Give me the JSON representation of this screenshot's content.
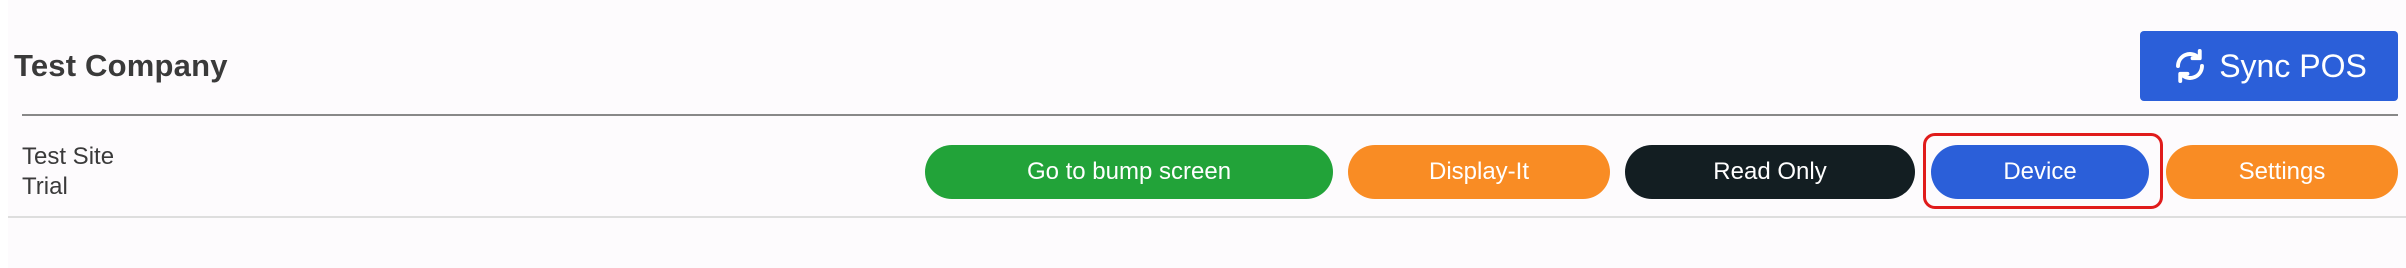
{
  "header": {
    "company_name": "Test Company",
    "sync_button_label": "Sync POS",
    "sync_icon": "sync-icon"
  },
  "site": {
    "name": "Test Site",
    "status": "Trial"
  },
  "actions": {
    "bump_screen_label": "Go to bump screen",
    "display_it_label": "Display-It",
    "read_only_label": "Read Only",
    "device_label": "Device",
    "settings_label": "Settings"
  },
  "colors": {
    "primary_blue": "#2b5fd9",
    "green": "#22a339",
    "orange": "#f98c24",
    "dark": "#131e22",
    "highlight_red": "#e01b1b"
  }
}
